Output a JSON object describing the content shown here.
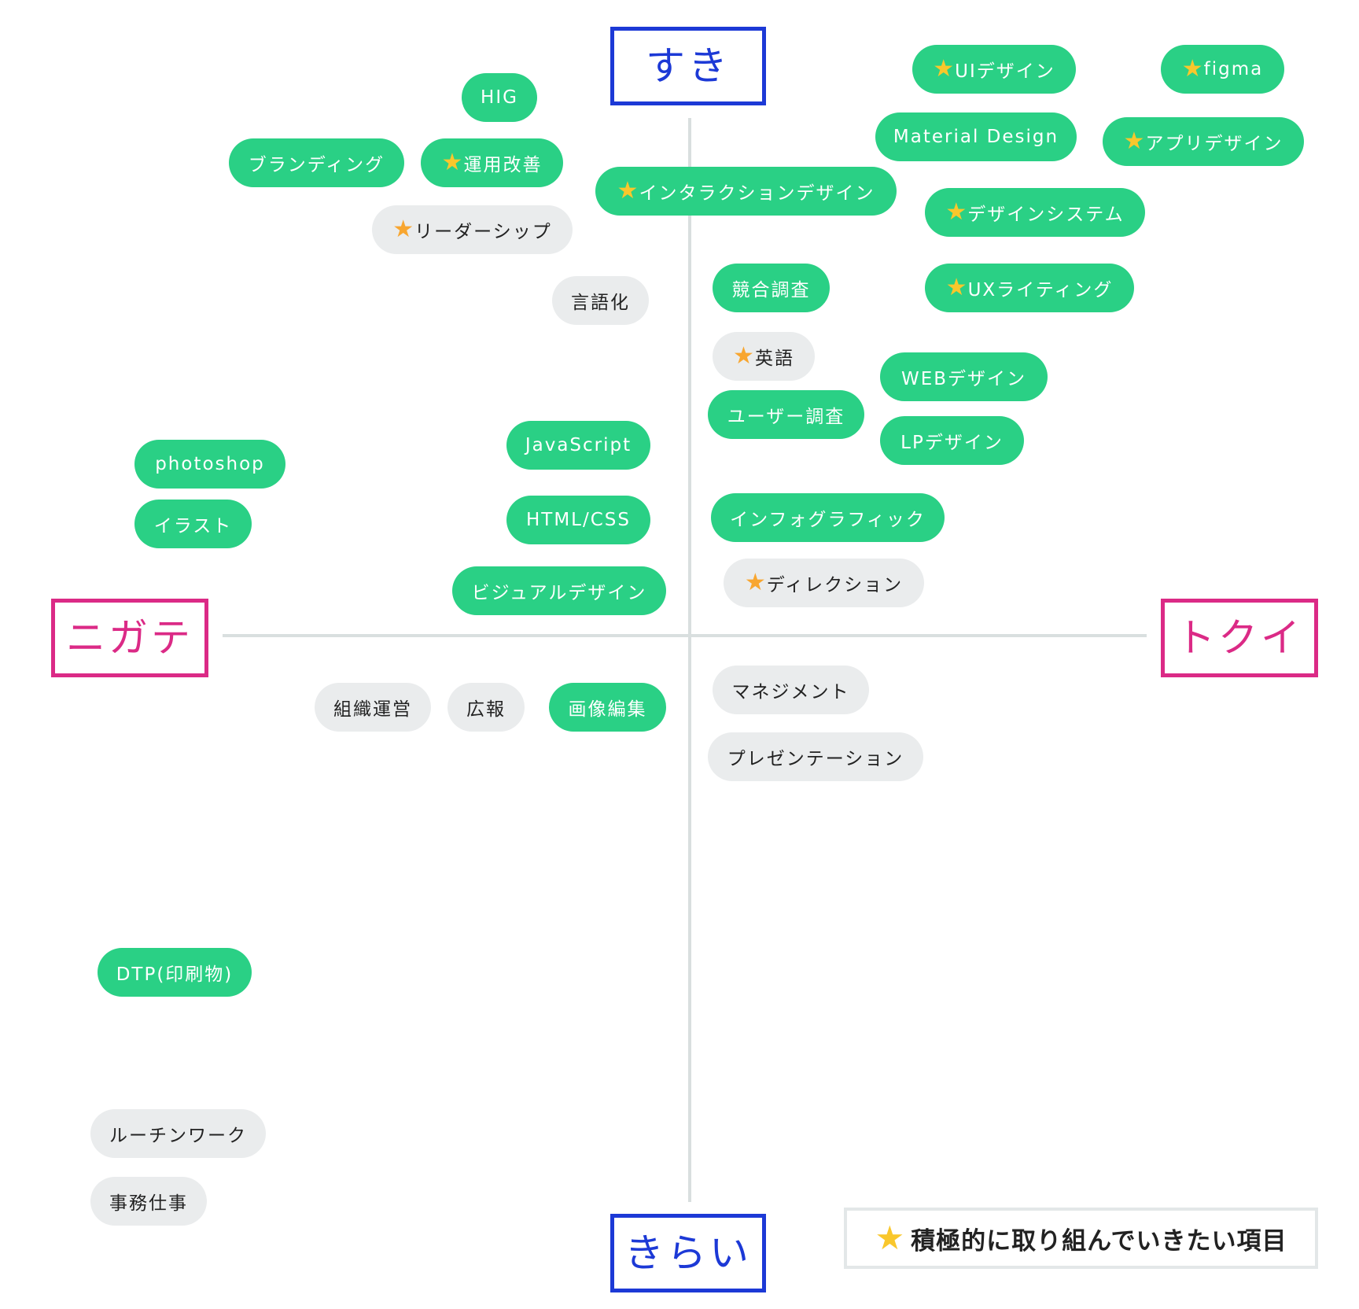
{
  "axes": {
    "top": "すき",
    "bottom": "きらい",
    "left": "ニガテ",
    "right": "トクイ"
  },
  "legend": {
    "icon": "star-icon",
    "label": "積極的に取り組んでいきたい項目"
  },
  "colors": {
    "tag_green": "#2ad085",
    "tag_gray": "#eaeced",
    "axis_blue": "#1c39d6",
    "axis_pink": "#db2a86",
    "star": "#f9c72c"
  },
  "tags": [
    {
      "id": "ui-design",
      "label": "UIデザイン",
      "star": true,
      "style": "green"
    },
    {
      "id": "figma",
      "label": "figma",
      "star": true,
      "style": "green"
    },
    {
      "id": "hig",
      "label": "HIG",
      "star": false,
      "style": "green"
    },
    {
      "id": "material-design",
      "label": "Material Design",
      "star": false,
      "style": "green"
    },
    {
      "id": "app-design",
      "label": "アプリデザイン",
      "star": true,
      "style": "green"
    },
    {
      "id": "branding",
      "label": "ブランディング",
      "star": false,
      "style": "green"
    },
    {
      "id": "operation-improvement",
      "label": "運用改善",
      "star": true,
      "style": "green"
    },
    {
      "id": "interaction-design",
      "label": "インタラクションデザイン",
      "star": true,
      "style": "green"
    },
    {
      "id": "design-system",
      "label": "デザインシステム",
      "star": true,
      "style": "green"
    },
    {
      "id": "leadership",
      "label": "リーダーシップ",
      "star": true,
      "style": "gray"
    },
    {
      "id": "verbalization",
      "label": "言語化",
      "star": false,
      "style": "gray"
    },
    {
      "id": "competitive-research",
      "label": "競合調査",
      "star": false,
      "style": "green"
    },
    {
      "id": "ux-writing",
      "label": "UXライティング",
      "star": true,
      "style": "green"
    },
    {
      "id": "english",
      "label": "英語",
      "star": true,
      "style": "gray"
    },
    {
      "id": "web-design",
      "label": "WEBデザイン",
      "star": false,
      "style": "green"
    },
    {
      "id": "user-research",
      "label": "ユーザー調査",
      "star": false,
      "style": "green"
    },
    {
      "id": "javascript",
      "label": "JavaScript",
      "star": false,
      "style": "green"
    },
    {
      "id": "lp-design",
      "label": "LPデザイン",
      "star": false,
      "style": "green"
    },
    {
      "id": "photoshop",
      "label": "photoshop",
      "star": false,
      "style": "green"
    },
    {
      "id": "illustration",
      "label": "イラスト",
      "star": false,
      "style": "green"
    },
    {
      "id": "html-css",
      "label": "HTML/CSS",
      "star": false,
      "style": "green"
    },
    {
      "id": "infographic",
      "label": "インフォグラフィック",
      "star": false,
      "style": "green"
    },
    {
      "id": "visual-design",
      "label": "ビジュアルデザイン",
      "star": false,
      "style": "green"
    },
    {
      "id": "direction",
      "label": "ディレクション",
      "star": true,
      "style": "gray"
    },
    {
      "id": "management",
      "label": "マネジメント",
      "star": false,
      "style": "gray"
    },
    {
      "id": "org-management",
      "label": "組織運営",
      "star": false,
      "style": "gray"
    },
    {
      "id": "pr",
      "label": "広報",
      "star": false,
      "style": "gray"
    },
    {
      "id": "image-editing",
      "label": "画像編集",
      "star": false,
      "style": "green"
    },
    {
      "id": "presentation",
      "label": "プレゼンテーション",
      "star": false,
      "style": "gray"
    },
    {
      "id": "dtp",
      "label": "DTP(印刷物)",
      "star": false,
      "style": "green"
    },
    {
      "id": "routine-work",
      "label": "ルーチンワーク",
      "star": false,
      "style": "gray"
    },
    {
      "id": "office-work",
      "label": "事務仕事",
      "star": false,
      "style": "gray"
    }
  ]
}
